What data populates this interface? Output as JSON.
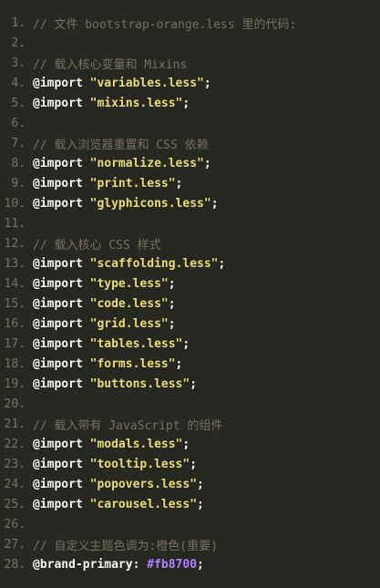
{
  "editor": {
    "lines": [
      {
        "n": "1.",
        "type": "comment",
        "text": "// 文件 bootstrap-orange.less 里的代码:"
      },
      {
        "n": "2.",
        "type": "blank"
      },
      {
        "n": "3.",
        "type": "comment",
        "text": "// 载入核心变量和 Mixins"
      },
      {
        "n": "4.",
        "type": "import",
        "kw": "@import",
        "str": "\"variables.less\"",
        "end": ";"
      },
      {
        "n": "5.",
        "type": "import",
        "kw": "@import",
        "str": "\"mixins.less\"",
        "end": ";"
      },
      {
        "n": "6.",
        "type": "blank"
      },
      {
        "n": "7.",
        "type": "comment",
        "text": "// 载入浏览器重置和 CSS 依赖"
      },
      {
        "n": "8.",
        "type": "import",
        "kw": "@import",
        "str": "\"normalize.less\"",
        "end": ";"
      },
      {
        "n": "9.",
        "type": "import",
        "kw": "@import",
        "str": "\"print.less\"",
        "end": ";"
      },
      {
        "n": "10.",
        "type": "import",
        "kw": "@import",
        "str": "\"glyphicons.less\"",
        "end": ";"
      },
      {
        "n": "11.",
        "type": "blank"
      },
      {
        "n": "12.",
        "type": "comment",
        "text": "// 载入核心 CSS 样式"
      },
      {
        "n": "13.",
        "type": "import",
        "kw": "@import",
        "str": "\"scaffolding.less\"",
        "end": ";"
      },
      {
        "n": "14.",
        "type": "import",
        "kw": "@import",
        "str": "\"type.less\"",
        "end": ";"
      },
      {
        "n": "15.",
        "type": "import",
        "kw": "@import",
        "str": "\"code.less\"",
        "end": ";"
      },
      {
        "n": "16.",
        "type": "import",
        "kw": "@import",
        "str": "\"grid.less\"",
        "end": ";"
      },
      {
        "n": "17.",
        "type": "import",
        "kw": "@import",
        "str": "\"tables.less\"",
        "end": ";"
      },
      {
        "n": "18.",
        "type": "import",
        "kw": "@import",
        "str": "\"forms.less\"",
        "end": ";"
      },
      {
        "n": "19.",
        "type": "import",
        "kw": "@import",
        "str": "\"buttons.less\"",
        "end": ";"
      },
      {
        "n": "20.",
        "type": "blank"
      },
      {
        "n": "21.",
        "type": "comment",
        "text": "// 载入带有 JavaScript 的组件"
      },
      {
        "n": "22.",
        "type": "import",
        "kw": "@import",
        "str": "\"modals.less\"",
        "end": ";"
      },
      {
        "n": "23.",
        "type": "import",
        "kw": "@import",
        "str": "\"tooltip.less\"",
        "end": ";"
      },
      {
        "n": "24.",
        "type": "import",
        "kw": "@import",
        "str": "\"popovers.less\"",
        "end": ";"
      },
      {
        "n": "25.",
        "type": "import",
        "kw": "@import",
        "str": "\"carousel.less\"",
        "end": ";"
      },
      {
        "n": "26.",
        "type": "blank"
      },
      {
        "n": "27.",
        "type": "comment",
        "text": "// 自定义主题色调为:橙色(重要)"
      },
      {
        "n": "28.",
        "type": "assign",
        "var": "@brand-primary",
        "sep": ": ",
        "val": "#fb8700",
        "end": ";"
      }
    ]
  },
  "colors": {
    "background": "#272822",
    "comment": "#75715e",
    "string": "#e6db74",
    "keyword": "#f8f8f2",
    "number": "#ae81ff"
  }
}
